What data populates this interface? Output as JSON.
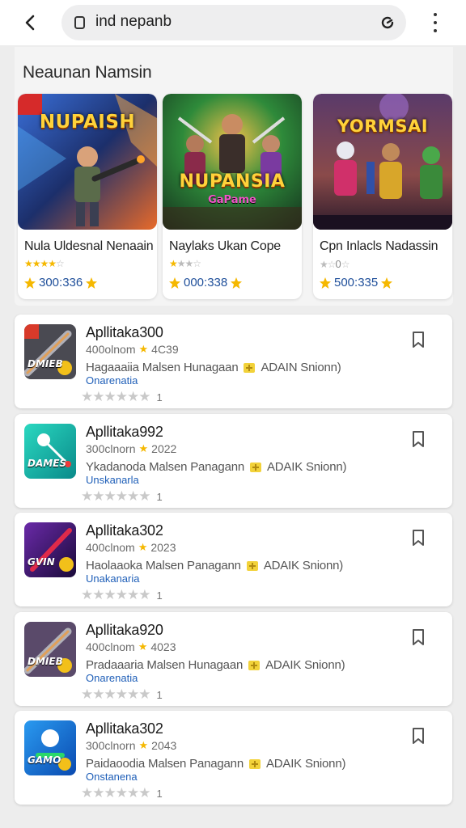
{
  "topbar": {
    "search_text": "ind nepanb"
  },
  "featured": {
    "title": "Neaunan Namsin",
    "cards": [
      {
        "art_title": "NUPAISH",
        "name": "Nula Uldesnal Nenaain",
        "rating": 4,
        "price": "300:336"
      },
      {
        "art_title": "NUPANSIA",
        "art_sub": "GaPame",
        "name": "Naylaks Ukan Cope",
        "rating": 1,
        "price": "000:338"
      },
      {
        "art_title": "YORMSAI",
        "name": "Cpn Inlacls Nadassin",
        "rating": 1,
        "rating_text": "0",
        "price": "500:335"
      }
    ]
  },
  "apps": [
    {
      "name": "Apllitaka300",
      "downloads": "400olnom",
      "score": "4C39",
      "desc": "Hagaaaiia Malsen Hunagaan",
      "tag": "ADAIN Snionn)",
      "link": "Onarenatia",
      "rating_count": "1",
      "icon_label": "DMIEB"
    },
    {
      "name": "Apllitaka992",
      "downloads": "300clnorn",
      "score": "2022",
      "desc": "Ykadanoda Malsen Panagann",
      "tag": "ADAIK Snionn)",
      "link": "Unskanarla",
      "rating_count": "1",
      "icon_label": "DAMES"
    },
    {
      "name": "Apllitaka302",
      "downloads": "400clnom",
      "score": "2023",
      "desc": "Haolaaoka Malsen Panagann",
      "tag": "ADAIK Snionn)",
      "link": "Unakanaria",
      "rating_count": "1",
      "icon_label": "GVIN"
    },
    {
      "name": "Apllitaka920",
      "downloads": "400clnom",
      "score": "4023",
      "desc": "Pradaaaria Malsen Hunagaan",
      "tag": "ADAIK Snionn)",
      "link": "Onarenatia",
      "rating_count": "1",
      "icon_label": "DMIEB"
    },
    {
      "name": "Apllitaka302",
      "downloads": "300clnorn",
      "score": "2043",
      "desc": "Paidaoodia Malsen Panagann",
      "tag": "ADAIK Snionn)",
      "link": "Onstanena",
      "rating_count": "1",
      "icon_label": "GAMO"
    }
  ],
  "colors": {
    "accent": "#1f5fb8",
    "star": "#f5b800",
    "background": "#ededed"
  }
}
